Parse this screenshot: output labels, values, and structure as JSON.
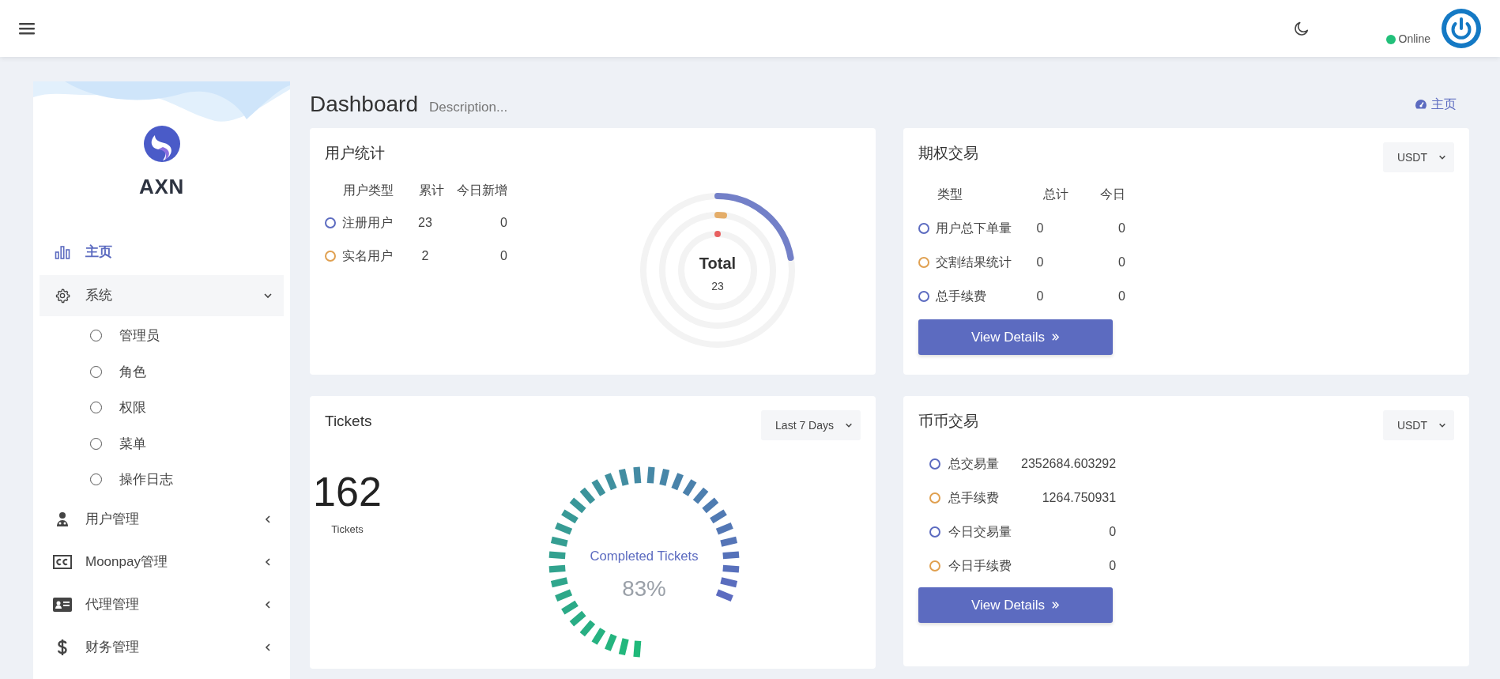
{
  "header": {
    "online_label": "Online"
  },
  "sidebar": {
    "brand": "AXN",
    "items": [
      {
        "label": "主页",
        "kind": "chart",
        "selected": true,
        "expanded": false
      },
      {
        "label": "系统",
        "kind": "gear",
        "selected": false,
        "expanded": true,
        "children": [
          {
            "label": "管理员",
            "selected": false
          },
          {
            "label": "角色",
            "selected": false
          },
          {
            "label": "权限",
            "selected": false
          },
          {
            "label": "菜单",
            "selected": false
          },
          {
            "label": "操作日志",
            "selected": false
          }
        ]
      },
      {
        "label": "用户管理",
        "kind": "user",
        "selected": false,
        "expanded": false
      },
      {
        "label": "Moonpay管理",
        "kind": "cc",
        "selected": false,
        "expanded": false
      },
      {
        "label": "代理管理",
        "kind": "card",
        "selected": false,
        "expanded": false
      },
      {
        "label": "财务管理",
        "kind": "dollar",
        "selected": false,
        "expanded": false
      }
    ]
  },
  "page": {
    "title": "Dashboard",
    "description": "Description...",
    "breadcrumb": "主页"
  },
  "user_stats": {
    "title": "用户统计",
    "columns": [
      "用户类型",
      "累计",
      "今日新增"
    ],
    "rows": [
      {
        "label": "注册用户",
        "total": "23",
        "today": "0",
        "color": "#5c6bc0"
      },
      {
        "label": "实名用户",
        "total": "2",
        "today": "0",
        "color": "#e0a050"
      }
    ],
    "chart": {
      "center_label": "Total",
      "center_value": "23"
    }
  },
  "options_trading": {
    "title": "期权交易",
    "currency": "USDT",
    "columns": [
      "类型",
      "总计",
      "今日"
    ],
    "rows": [
      {
        "label": "用户总下单量",
        "total": "0",
        "today": "0",
        "color": "#5c6bc0"
      },
      {
        "label": "交割结果统计",
        "total": "0",
        "today": "0",
        "color": "#e0a050"
      },
      {
        "label": "总手续费",
        "total": "0",
        "today": "0",
        "color": "#5c6bc0"
      }
    ],
    "button": "View Details"
  },
  "tickets": {
    "title": "Tickets",
    "period": "Last 7 Days",
    "count": "162",
    "count_label": "Tickets",
    "gauge": {
      "label": "Completed Tickets",
      "value": "83%"
    }
  },
  "spot_trading": {
    "title": "币币交易",
    "currency": "USDT",
    "rows": [
      {
        "label": "总交易量",
        "value": "2352684.603292",
        "color": "#5c6bc0"
      },
      {
        "label": "总手续费",
        "value": "1264.750931",
        "color": "#e0a050"
      },
      {
        "label": "今日交易量",
        "value": "0",
        "color": "#5c6bc0"
      },
      {
        "label": "今日手续费",
        "value": "0",
        "color": "#e0a050"
      }
    ],
    "button": "View Details"
  }
}
